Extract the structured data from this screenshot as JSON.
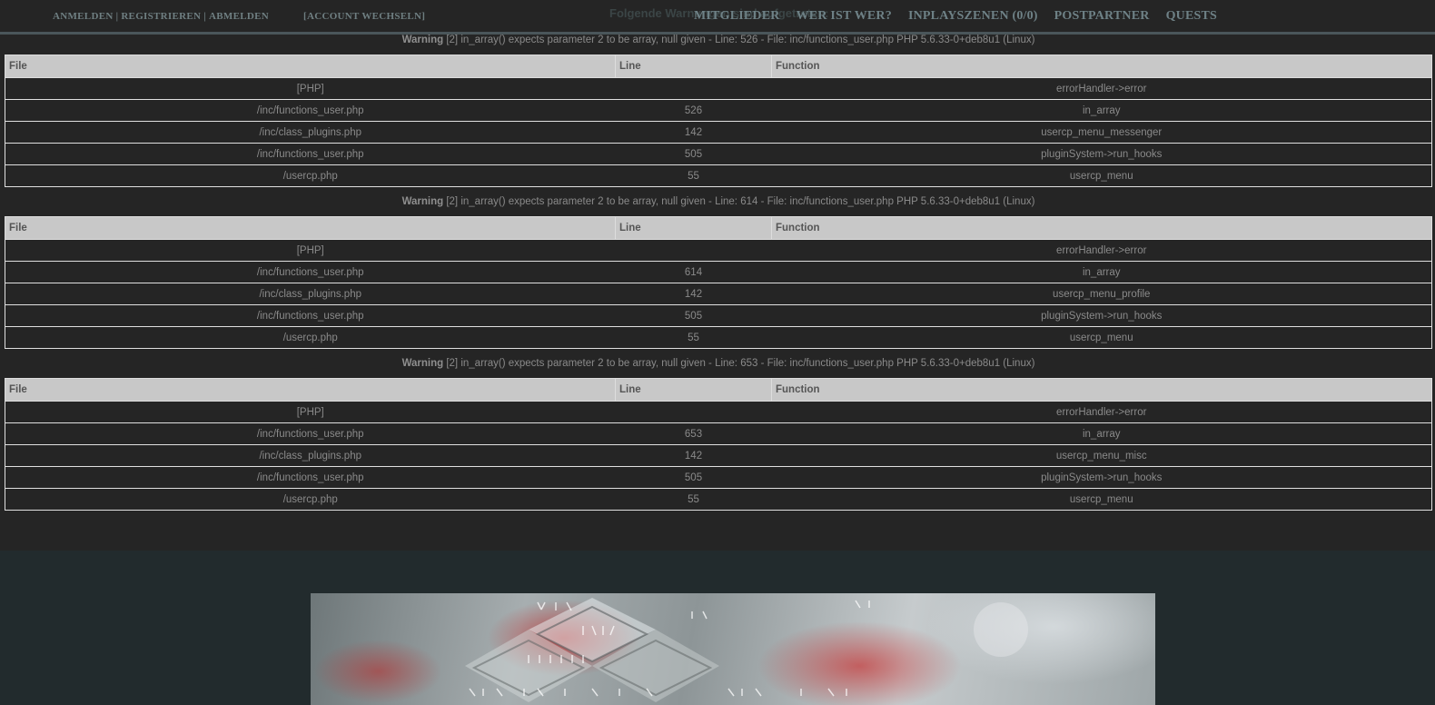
{
  "header": {
    "account_links": [
      "ANMELDEN",
      "REGISTRIEREN",
      "ABMELDEN"
    ],
    "account_switch": "[ACCOUNT WECHSELN]",
    "ghost_title": "Folgende Warnungen sind aufgetreten:",
    "nav": [
      "MITGLIEDER",
      "WER IST WER?",
      "INPLAYSZENEN (0/0)",
      "POSTPARTNER",
      "QUESTS"
    ]
  },
  "columns": {
    "file": "File",
    "line": "Line",
    "function": "Function"
  },
  "warnings": [
    {
      "label": "Warning",
      "message": "[2] in_array() expects parameter 2 to be array, null given - Line: 526 - File: inc/functions_user.php PHP 5.6.33-0+deb8u1 (Linux)",
      "rows": [
        {
          "file": "[PHP]",
          "line": "",
          "function": "errorHandler->error"
        },
        {
          "file": "/inc/functions_user.php",
          "line": "526",
          "function": "in_array"
        },
        {
          "file": "/inc/class_plugins.php",
          "line": "142",
          "function": "usercp_menu_messenger"
        },
        {
          "file": "/inc/functions_user.php",
          "line": "505",
          "function": "pluginSystem->run_hooks"
        },
        {
          "file": "/usercp.php",
          "line": "55",
          "function": "usercp_menu"
        }
      ]
    },
    {
      "label": "Warning",
      "message": "[2] in_array() expects parameter 2 to be array, null given - Line: 614 - File: inc/functions_user.php PHP 5.6.33-0+deb8u1 (Linux)",
      "rows": [
        {
          "file": "[PHP]",
          "line": "",
          "function": "errorHandler->error"
        },
        {
          "file": "/inc/functions_user.php",
          "line": "614",
          "function": "in_array"
        },
        {
          "file": "/inc/class_plugins.php",
          "line": "142",
          "function": "usercp_menu_profile"
        },
        {
          "file": "/inc/functions_user.php",
          "line": "505",
          "function": "pluginSystem->run_hooks"
        },
        {
          "file": "/usercp.php",
          "line": "55",
          "function": "usercp_menu"
        }
      ]
    },
    {
      "label": "Warning",
      "message": "[2] in_array() expects parameter 2 to be array, null given - Line: 653 - File: inc/functions_user.php PHP 5.6.33-0+deb8u1 (Linux)",
      "rows": [
        {
          "file": "[PHP]",
          "line": "",
          "function": "errorHandler->error"
        },
        {
          "file": "/inc/functions_user.php",
          "line": "653",
          "function": "in_array"
        },
        {
          "file": "/inc/class_plugins.php",
          "line": "142",
          "function": "usercp_menu_misc"
        },
        {
          "file": "/inc/functions_user.php",
          "line": "505",
          "function": "pluginSystem->run_hooks"
        },
        {
          "file": "/usercp.php",
          "line": "55",
          "function": "usercp_menu"
        }
      ]
    }
  ]
}
